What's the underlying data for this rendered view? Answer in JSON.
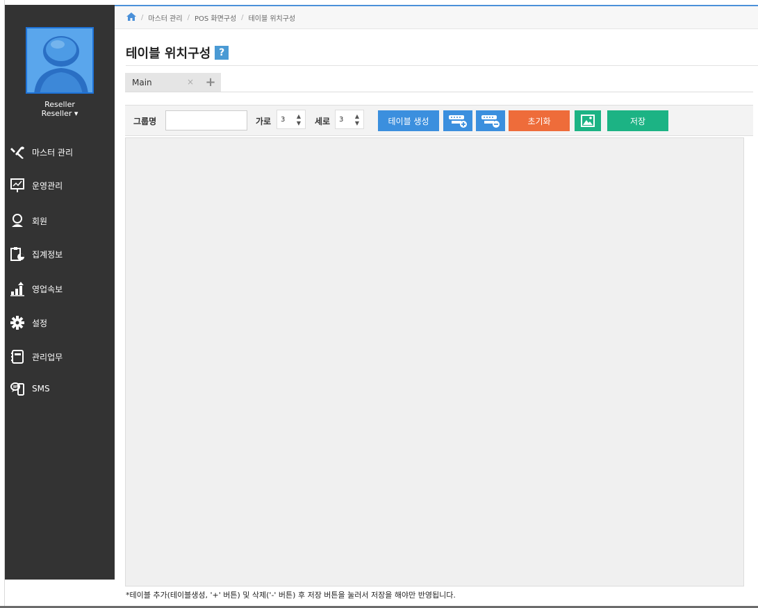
{
  "sidebar": {
    "user_name": "Reseller",
    "user_role": "Reseller ▾",
    "items": [
      {
        "label": "마스터 관리",
        "icon": "tools-icon"
      },
      {
        "label": "운영관리",
        "icon": "presentation-chart-icon"
      },
      {
        "label": "회원",
        "icon": "member-icon"
      },
      {
        "label": "집계정보",
        "icon": "clipboard-pie-icon"
      },
      {
        "label": "영업속보",
        "icon": "bar-growth-icon"
      },
      {
        "label": "설정",
        "icon": "gear-icon"
      },
      {
        "label": "관리업무",
        "icon": "notebook-icon"
      },
      {
        "label": "SMS",
        "icon": "phone-chat-icon"
      }
    ]
  },
  "breadcrumb": {
    "items": [
      "마스터 관리",
      "POS 화면구성",
      "테이블 위치구성"
    ]
  },
  "page": {
    "title": "테이블 위치구성",
    "help": "?"
  },
  "tabs": {
    "main_label": "Main",
    "close": "×",
    "add": "+"
  },
  "toolbar": {
    "group_label": "그룹명",
    "group_value": "",
    "width_label": "가로",
    "width_value": "3",
    "height_label": "세로",
    "height_value": "3",
    "create_label": "테이블 생성",
    "reset_label": "초기화",
    "save_label": "저장"
  },
  "colors": {
    "sidebar_bg": "#333333",
    "primary_blue": "#3b8fde",
    "reset_orange": "#ee6c3a",
    "save_green": "#1cb384"
  },
  "footnote": "*테이블 추가(테이블생성, '+' 버튼) 및 삭제('-' 버튼) 후 저장 버튼을 눌러서 저장을 해야만 반영됩니다."
}
